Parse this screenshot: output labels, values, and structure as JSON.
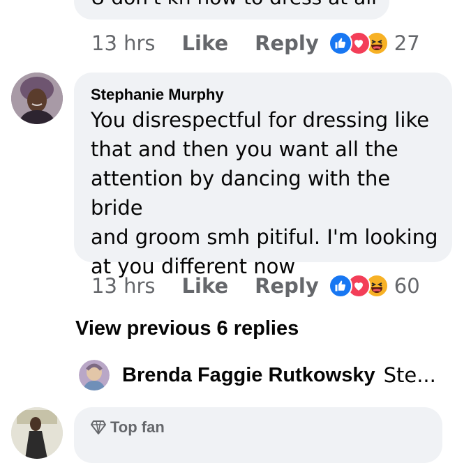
{
  "previous_comment": {
    "text_fragment": "U don't kn how to dress at all",
    "time": "13 hrs",
    "like_label": "Like",
    "reply_label": "Reply",
    "reaction_count": "27",
    "reactions": [
      "like-icon",
      "love-icon",
      "haha-icon"
    ]
  },
  "comment": {
    "author": "Stephanie Murphy",
    "lines": [
      "You  disrespectful for dressing like",
      "that and then you want all the",
      "attention by dancing with the bride",
      "and groom  smh pitiful.  I'm looking",
      "at you different now"
    ],
    "time": "13 hrs",
    "like_label": "Like",
    "reply_label": "Reply",
    "reaction_count": "60",
    "reactions": [
      "like-icon",
      "love-icon",
      "haha-icon"
    ]
  },
  "view_previous": "View previous 6 replies",
  "reply_preview": {
    "author": "Brenda Faggie Rutkowsky",
    "text": "Ste..."
  },
  "next_comment": {
    "badge": "Top fan",
    "badge_icon": "diamond-icon"
  },
  "colors": {
    "bubble": "#f0f2f5",
    "meta_text": "#65676b",
    "like_blue": "#1877f2",
    "love_red": "#f33e58",
    "haha_yellow": "#f7b125"
  }
}
